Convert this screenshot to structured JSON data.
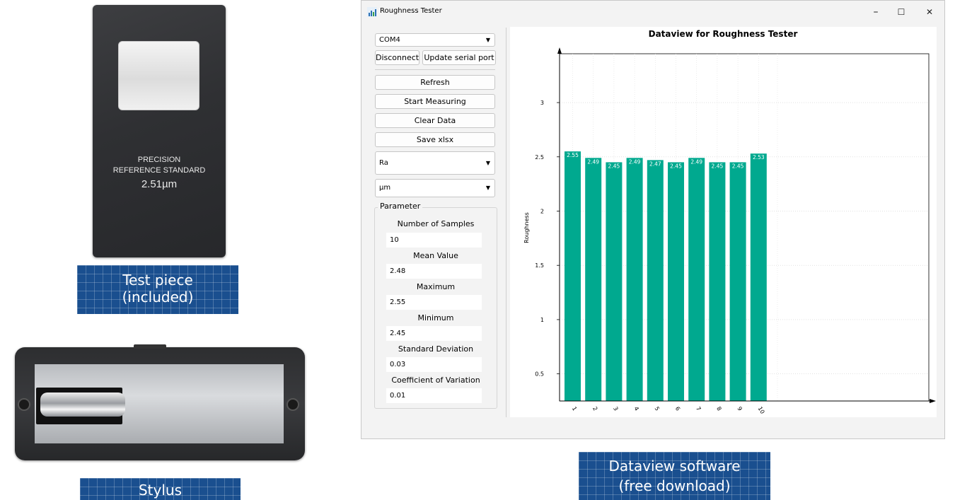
{
  "test_piece": {
    "label_line1": "PRECISION",
    "label_line2": "REFERENCE STANDARD",
    "label_value": "2.51µm",
    "caption_line1": "Test piece",
    "caption_line2": "(included)"
  },
  "stylus": {
    "caption": "Stylus"
  },
  "software_caption": {
    "line1": "Dataview software",
    "line2": "(free download)"
  },
  "app": {
    "title": "Roughness Tester",
    "controls": {
      "minimize": "–",
      "maximize": "☐",
      "close": "✕"
    },
    "port_select": "COM4",
    "disconnect_label": "Disconnect",
    "update_port_label": "Update serial port",
    "refresh_label": "Refresh",
    "start_label": "Start Measuring",
    "clear_label": "Clear Data",
    "save_label": "Save xlsx",
    "parameter_select": "Ra",
    "unit_select": "µm",
    "parameter_group": {
      "title": "Parameter",
      "fields": [
        {
          "label": "Number of Samples",
          "value": "10"
        },
        {
          "label": "Mean Value",
          "value": "2.48"
        },
        {
          "label": "Maximum",
          "value": "2.55"
        },
        {
          "label": "Minimum",
          "value": "2.45"
        },
        {
          "label": "Standard Deviation",
          "value": "0.03"
        },
        {
          "label": "Coefficient of Variation",
          "value": "0.01"
        }
      ]
    }
  },
  "colors": {
    "bar": "#00a98f",
    "caption_bg": "#1a4f8f"
  },
  "chart_data": {
    "type": "bar",
    "title": "Dataview for Roughness Tester",
    "xlabel": "",
    "ylabel": "Roughness",
    "categories": [
      "1",
      "2",
      "3",
      "4",
      "5",
      "6",
      "7",
      "8",
      "9",
      "10"
    ],
    "values": [
      2.55,
      2.49,
      2.45,
      2.49,
      2.47,
      2.45,
      2.49,
      2.45,
      2.45,
      2.53
    ],
    "value_labels": [
      "2.55",
      "2.49",
      "2.45",
      "2.49",
      "2.47",
      "2.45",
      "2.49",
      "2.45",
      "2.45",
      "2.53"
    ],
    "yticks": [
      "0.5",
      "1",
      "1.5",
      "2",
      "2.5",
      "3"
    ],
    "ytick_values": [
      0.5,
      1,
      1.5,
      2,
      2.5,
      3
    ],
    "ylim": [
      0.25,
      3.45
    ],
    "grid": true
  }
}
